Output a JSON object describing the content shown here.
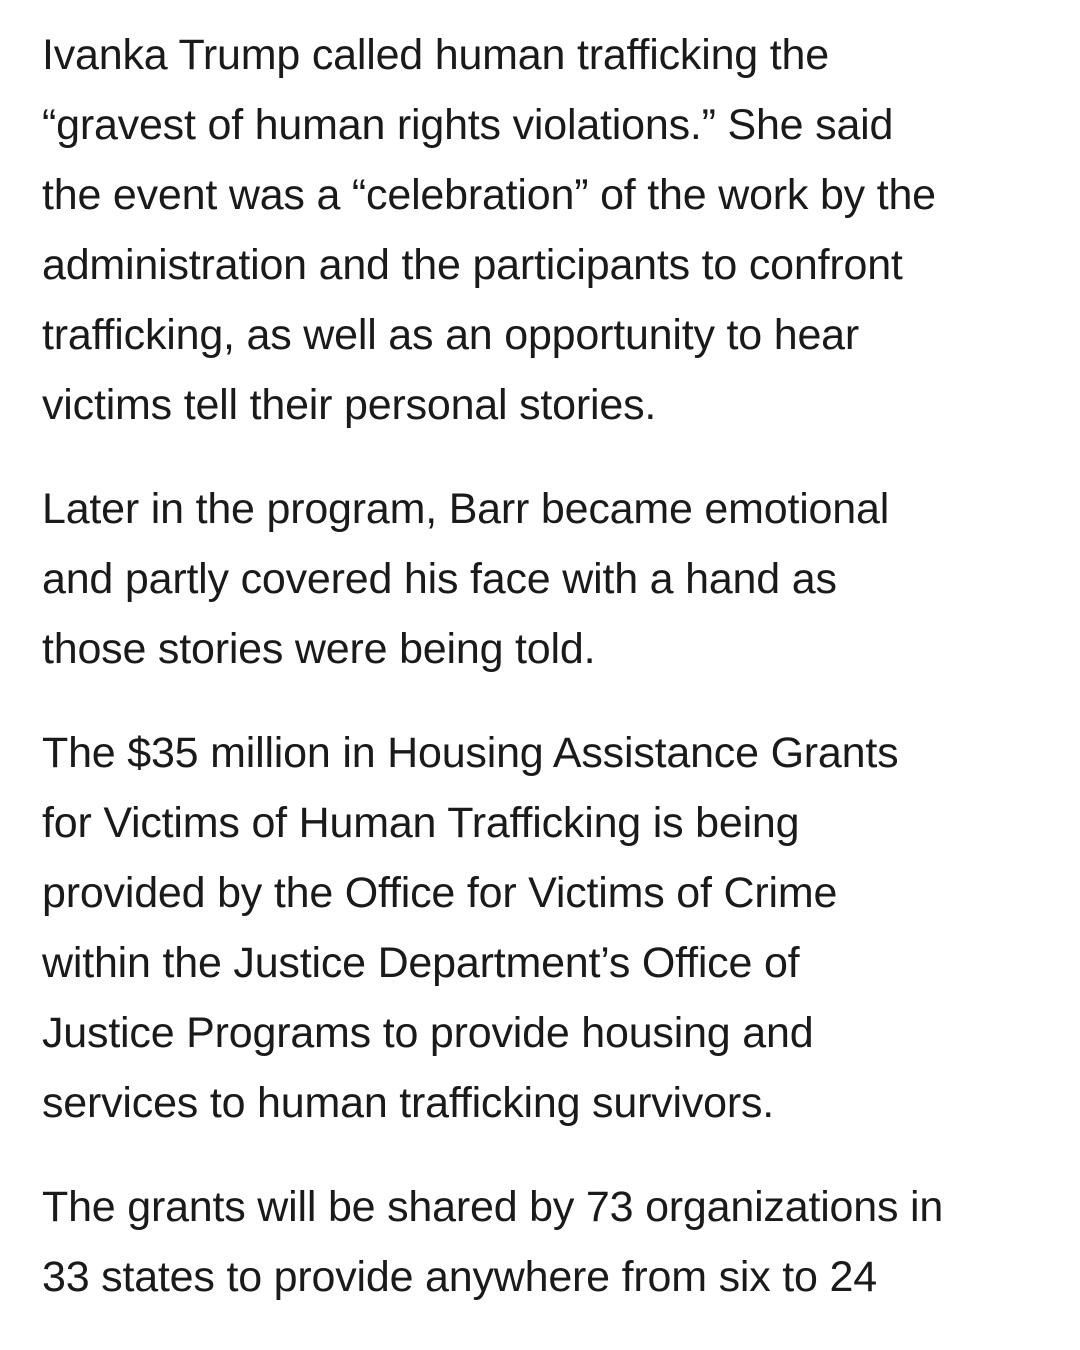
{
  "article": {
    "paragraphs": [
      {
        "lines": [
          "Ivanka Trump called human trafficking the",
          "“gravest of human rights violations.” She said",
          "the event was a “celebration” of the work by the",
          "administration and the participants to confront",
          "trafficking, as well as an opportunity to hear",
          "victims tell their personal stories."
        ]
      },
      {
        "lines": [
          "Later in the program, Barr became emotional",
          "and partly covered his face with a hand as",
          "those stories were being told."
        ]
      },
      {
        "lines": [
          "The $35 million in Housing Assistance Grants",
          "for Victims of Human Trafficking is being",
          "provided by the Office for Victims of Crime",
          "within the Justice Department’s Office of",
          "Justice Programs to provide housing and",
          "services to human trafficking survivors."
        ]
      },
      {
        "lines": [
          "The grants will be shared by 73 organizations in",
          "33 states to provide anywhere from six to 24"
        ]
      }
    ]
  }
}
